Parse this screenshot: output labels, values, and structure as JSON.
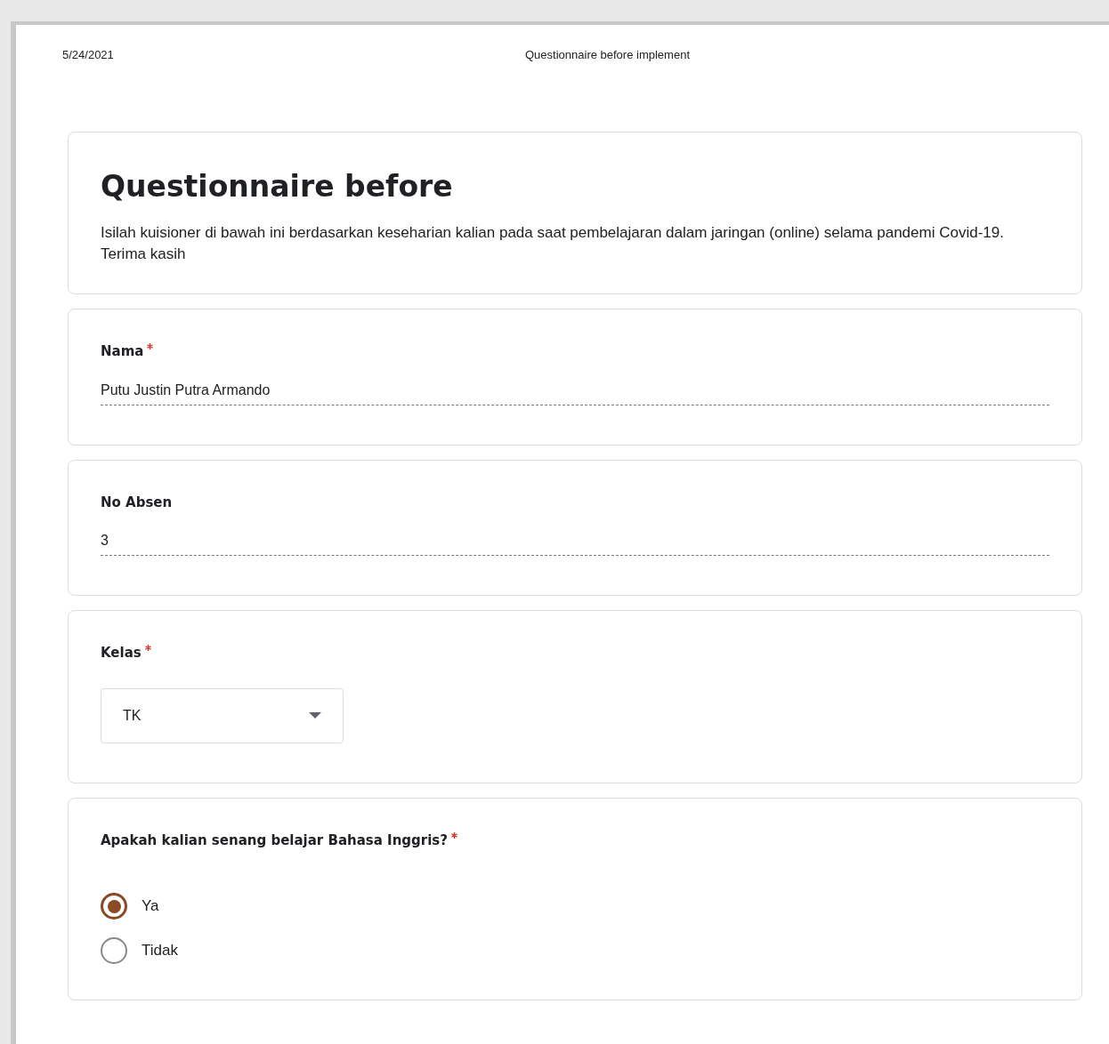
{
  "print_header": {
    "date": "5/24/2021",
    "title": "Questionnaire before implement"
  },
  "form": {
    "title": "Questionnaire before",
    "description": "Isilah kuisioner di bawah ini berdasarkan keseharian kalian pada saat pembelajaran dalam jaringan (online) selama pandemi Covid-19. Terima kasih"
  },
  "questions": [
    {
      "kind": "text",
      "label": "Nama",
      "required": true,
      "value": "Putu Justin Putra Armando"
    },
    {
      "kind": "text",
      "label": "No Absen",
      "required": false,
      "value": "3"
    },
    {
      "kind": "dropdown",
      "label": "Kelas",
      "required": true,
      "value": "TK"
    },
    {
      "kind": "radio",
      "label": "Apakah kalian senang belajar Bahasa Inggris?",
      "required": true,
      "options": [
        {
          "label": "Ya",
          "selected": true
        },
        {
          "label": "Tidak",
          "selected": false
        }
      ]
    }
  ]
}
